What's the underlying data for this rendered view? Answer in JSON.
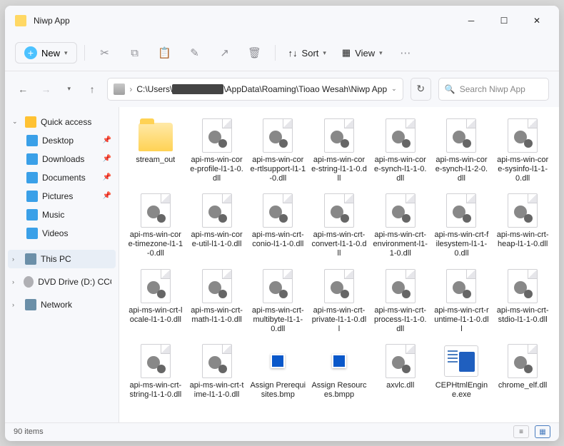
{
  "window": {
    "title": "Niwp App"
  },
  "toolbar": {
    "new": "New",
    "sort": "Sort",
    "view": "View"
  },
  "address": {
    "prefix": "C:\\Users\\",
    "redacted": "████████",
    "suffix": "\\AppData\\Roaming\\Tioao Wesah\\Niwp App"
  },
  "search": {
    "placeholder": "Search Niwp App"
  },
  "sidebar": {
    "quick": "Quick access",
    "desktop": "Desktop",
    "downloads": "Downloads",
    "documents": "Documents",
    "pictures": "Pictures",
    "music": "Music",
    "videos": "Videos",
    "thispc": "This PC",
    "dvd": "DVD Drive (D:) CCCO",
    "network": "Network"
  },
  "items": [
    {
      "name": "stream_out",
      "type": "folder"
    },
    {
      "name": "api-ms-win-core-profile-l1-1-0.dll",
      "type": "dll"
    },
    {
      "name": "api-ms-win-core-rtlsupport-l1-1-0.dll",
      "type": "dll"
    },
    {
      "name": "api-ms-win-core-string-l1-1-0.dll",
      "type": "dll"
    },
    {
      "name": "api-ms-win-core-synch-l1-1-0.dll",
      "type": "dll"
    },
    {
      "name": "api-ms-win-core-synch-l1-2-0.dll",
      "type": "dll"
    },
    {
      "name": "api-ms-win-core-sysinfo-l1-1-0.dll",
      "type": "dll"
    },
    {
      "name": "api-ms-win-core-timezone-l1-1-0.dll",
      "type": "dll"
    },
    {
      "name": "api-ms-win-core-util-l1-1-0.dll",
      "type": "dll"
    },
    {
      "name": "api-ms-win-crt-conio-l1-1-0.dll",
      "type": "dll"
    },
    {
      "name": "api-ms-win-crt-convert-l1-1-0.dll",
      "type": "dll"
    },
    {
      "name": "api-ms-win-crt-environment-l1-1-0.dll",
      "type": "dll"
    },
    {
      "name": "api-ms-win-crt-filesystem-l1-1-0.dll",
      "type": "dll"
    },
    {
      "name": "api-ms-win-crt-heap-l1-1-0.dll",
      "type": "dll"
    },
    {
      "name": "api-ms-win-crt-locale-l1-1-0.dll",
      "type": "dll"
    },
    {
      "name": "api-ms-win-crt-math-l1-1-0.dll",
      "type": "dll"
    },
    {
      "name": "api-ms-win-crt-multibyte-l1-1-0.dll",
      "type": "dll"
    },
    {
      "name": "api-ms-win-crt-private-l1-1-0.dll",
      "type": "dll"
    },
    {
      "name": "api-ms-win-crt-process-l1-1-0.dll",
      "type": "dll"
    },
    {
      "name": "api-ms-win-crt-runtime-l1-1-0.dll",
      "type": "dll"
    },
    {
      "name": "api-ms-win-crt-stdio-l1-1-0.dll",
      "type": "dll"
    },
    {
      "name": "api-ms-win-crt-string-l1-1-0.dll",
      "type": "dll"
    },
    {
      "name": "api-ms-win-crt-time-l1-1-0.dll",
      "type": "dll"
    },
    {
      "name": "Assign Prerequisites.bmp",
      "type": "bmp"
    },
    {
      "name": "Assign Resources.bmpp",
      "type": "bmp"
    },
    {
      "name": "axvlc.dll",
      "type": "dll"
    },
    {
      "name": "CEPHtmlEngine.exe",
      "type": "exe"
    },
    {
      "name": "chrome_elf.dll",
      "type": "dll"
    }
  ],
  "status": {
    "count": "90 items"
  }
}
